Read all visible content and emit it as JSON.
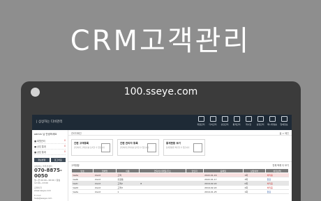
{
  "hero": {
    "title": "CRM고객관리"
  },
  "browser": {
    "url": "100.sseye.com"
  },
  "app": {
    "logo": "| 상상하는 디비관리",
    "nav": [
      {
        "label": "회원관리",
        "icon": "users-icon"
      },
      {
        "label": "디비관리",
        "icon": "pen-icon"
      },
      {
        "label": "상담관리",
        "icon": "box-icon"
      },
      {
        "label": "통계관리",
        "icon": "chart-icon"
      },
      {
        "label": "게시판",
        "icon": "board-icon"
      },
      {
        "label": "설정관리",
        "icon": "gear-icon"
      },
      {
        "label": "메시지발송",
        "icon": "message-icon"
      },
      {
        "label": "업체정보",
        "icon": "info-icon"
      }
    ]
  },
  "sidebar": {
    "user": "admin 님 안녕하세요",
    "menu": [
      {
        "label": "■ 회원관리",
        "count": "0"
      },
      {
        "label": "■ 상담 통계",
        "count": "0"
      },
      {
        "label": "■ 상담 통계",
        "count": "0"
      }
    ],
    "buttons": [
      "정보변경",
      "로그아웃"
    ],
    "support_label": "상상하는 솔루션센터",
    "phone": "070-8875-0050",
    "phone_note": "월~금 09:00~18:00 / 점심 12:00~13:00",
    "homepage_label": "홈페이지",
    "homepage": "www.sseye.com",
    "email_label": "E-mail",
    "email": "help@sseye.com"
  },
  "main": {
    "breadcrumb": "관리자메인",
    "breadcrumb_right": "홈 > 메인",
    "cards": [
      {
        "title": "간편 고객등록",
        "desc": "간편하게 고객정보를 등록할 수 있습니다",
        "icon": "signature-icon"
      },
      {
        "title": "간편 관리자 등록",
        "desc": "간편하게 관리자를 등록할 수 있습니다",
        "icon": "gear-icon"
      },
      {
        "title": "통계현황 보기",
        "desc": "통계현황을 확인할 수 있습니다",
        "icon": "person-card-icon"
      }
    ],
    "table_title": "고객현황",
    "table_right": "전체 목록 더 보기",
    "columns": [
      "번호",
      "업체명",
      "이름",
      "연락처/이메일/주소",
      "담당자",
      "등록일",
      "상담여부",
      "처리상태"
    ],
    "rows": [
      {
        "style": "pink",
        "cells": [
          "testa",
          "client",
          "고객",
          "",
          "",
          "2022-01-16",
          "1회",
          "처리중"
        ],
        "status": "red"
      },
      {
        "style": "",
        "cells": [
          "testb",
          "client",
          "홍길동",
          "",
          "",
          "2022-01-17",
          "3회",
          "완료"
        ],
        "status": "blue"
      },
      {
        "style": "gray",
        "cells": [
          "testc",
          "client",
          "고객2",
          "8",
          "",
          "2019-02-22",
          "0회",
          "처리중"
        ],
        "status": "red"
      },
      {
        "style": "",
        "cells": [
          "testd",
          "client",
          "고객3",
          "",
          "",
          "2019-02-22",
          "2회",
          "처리중"
        ],
        "status": "red"
      },
      {
        "style": "",
        "cells": [
          "teste",
          "client",
          "1",
          "",
          "",
          "2019-01-25",
          "1회",
          "완료"
        ],
        "status": "blue"
      }
    ]
  },
  "colors": {
    "background": "#8e8e8e",
    "topbar": "#1e2a36",
    "accent_red": "#cc3333",
    "accent_blue": "#2d5ca8"
  }
}
